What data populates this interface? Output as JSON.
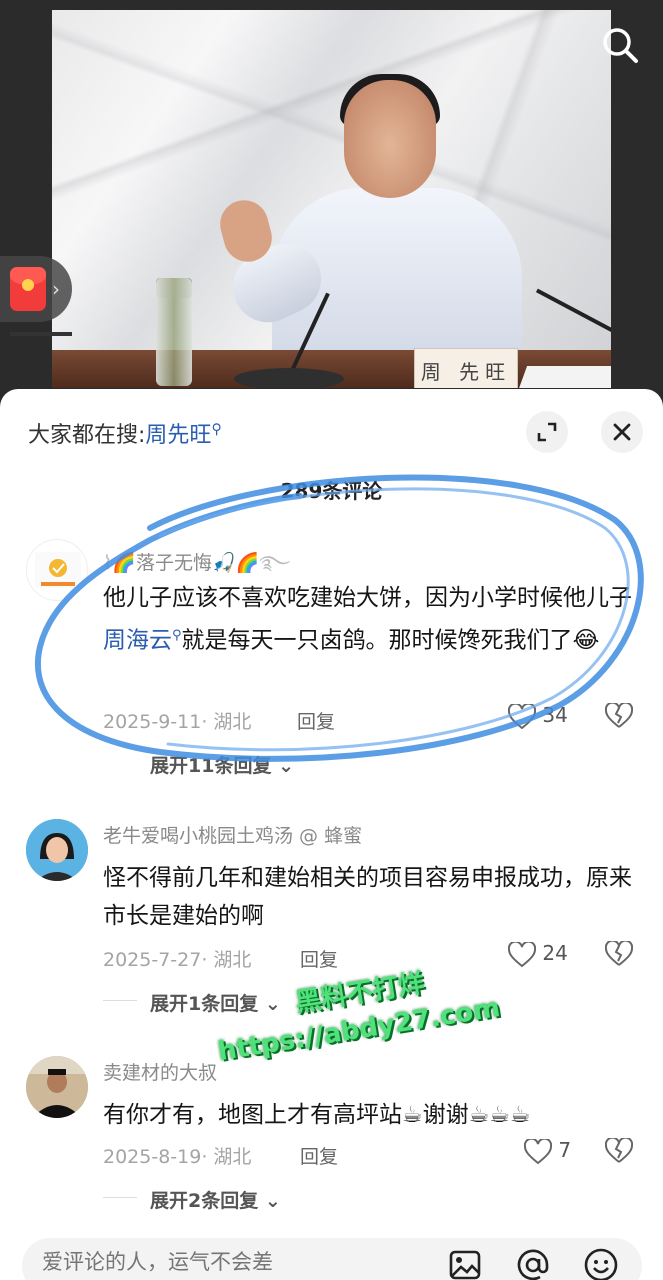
{
  "video": {
    "nameplate": "周 先旺"
  },
  "sheet": {
    "search_prefix": "大家都在搜:",
    "search_term": "周先旺",
    "comment_count": "289条评论"
  },
  "comments": [
    {
      "author": "落子无悔",
      "text_part1": "他儿子应该不喜欢吃建始大饼，因为小学时候他儿子",
      "link": "周海云",
      "text_part2": "就是每天一只卤鸽。那时候馋死我们了",
      "date_loc": "2025-9-11· 湖北",
      "reply": "回复",
      "likes": "34",
      "expand": "展开11条回复"
    },
    {
      "author": "老牛爱喝小桃园土鸡汤 @ 蜂蜜",
      "text": "怪不得前几年和建始相关的项目容易申报成功，原来市长是建始的啊",
      "date_loc": "2025-7-27· 湖北",
      "reply": "回复",
      "likes": "24",
      "expand": "展开1条回复"
    },
    {
      "author": "卖建材的大叔",
      "text": "有你才有，地图上才有高坪站☕谢谢☕☕☕",
      "date_loc": "2025-8-19· 湖北",
      "reply": "回复",
      "likes": "7",
      "expand": "展开2条回复"
    }
  ],
  "watermark": {
    "line1": "黑料不打烊",
    "line2": "https://abdy27.com"
  },
  "input": {
    "placeholder": "爱评论的人，运气不会差"
  },
  "colors": {
    "link": "#2a5db0",
    "scribble": "#3f8de0",
    "watermark": "#4fe27a"
  }
}
